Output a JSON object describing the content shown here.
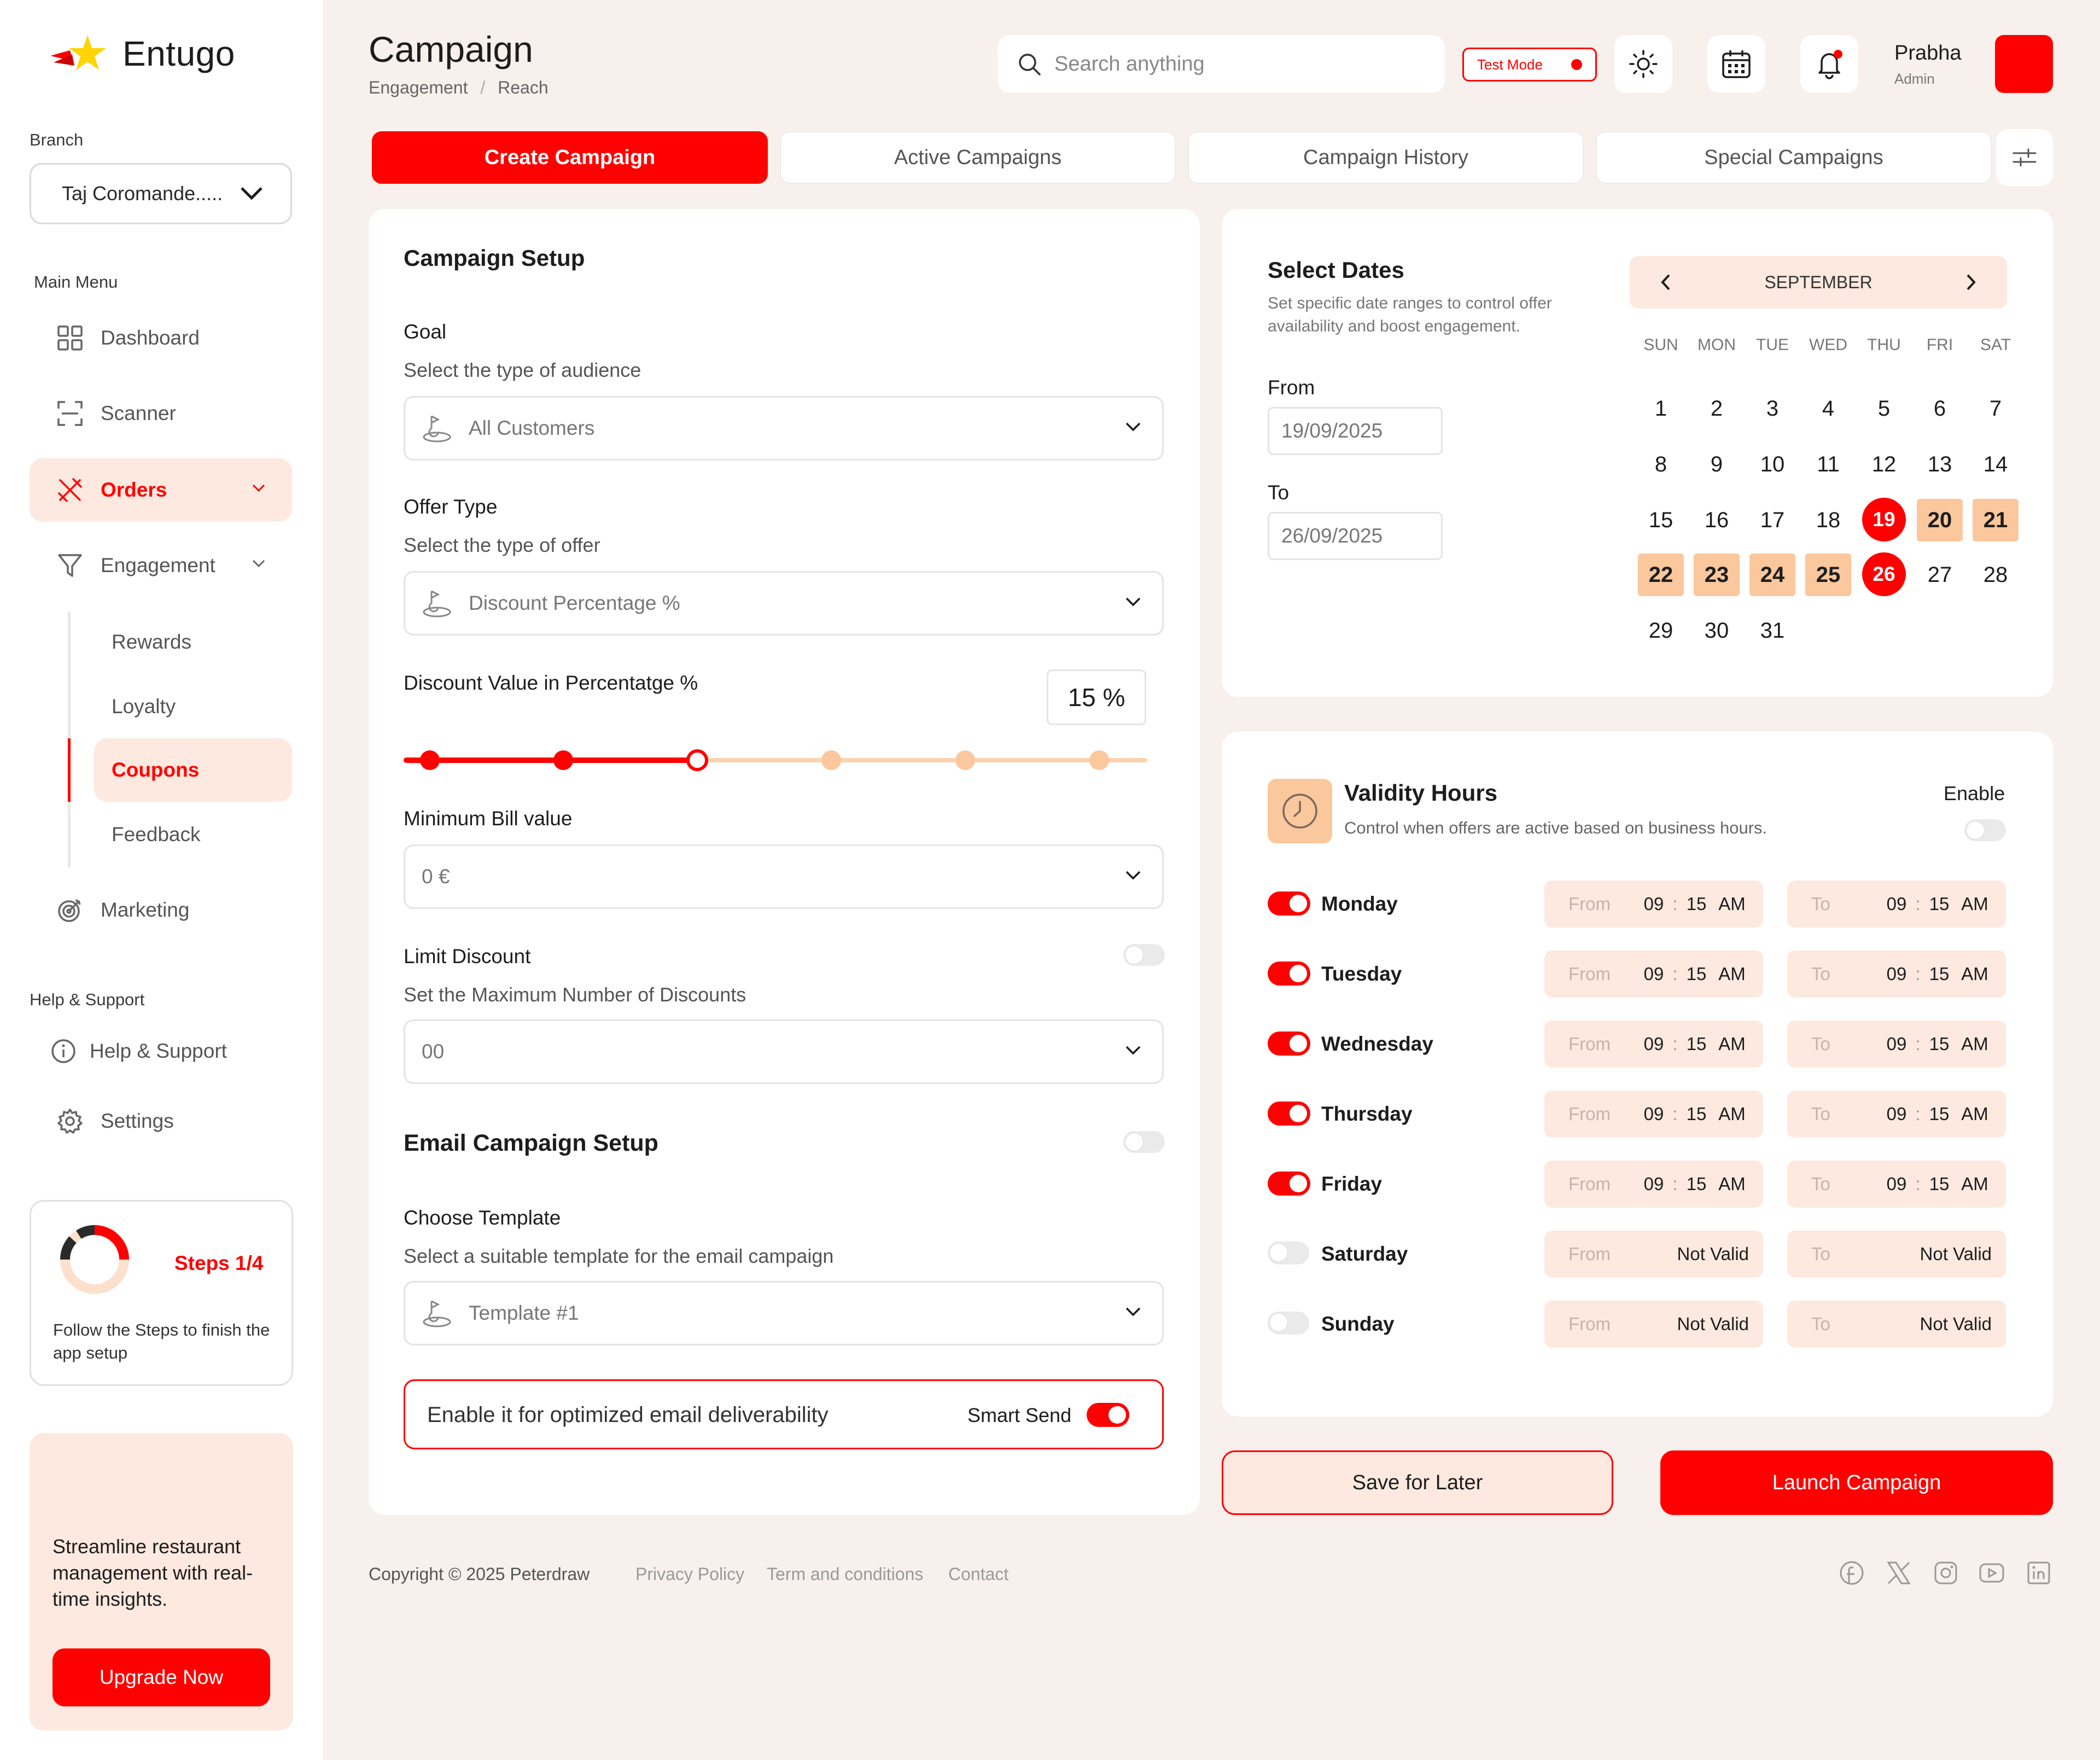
{
  "app": {
    "name": "Entugo"
  },
  "sidebar": {
    "branch_label": "Branch",
    "branch_value": "Taj Coromande.....",
    "main_menu_label": "Main Menu",
    "items": {
      "dashboard": "Dashboard",
      "scanner": "Scanner",
      "orders": "Orders",
      "engagement": "Engagement",
      "marketing": "Marketing"
    },
    "sub_items": {
      "rewards": "Rewards",
      "loyalty": "Loyalty",
      "coupons": "Coupons",
      "feedback": "Feedback"
    },
    "help_label": "Help & Support",
    "help_items": {
      "help": "Help & Support",
      "settings": "Settings"
    },
    "steps": {
      "label": "Steps 1/4",
      "text": "Follow the Steps to finish the  app setup",
      "progress": 0.25
    },
    "upgrade": {
      "text": "Streamline restaurant management with real-time insights.",
      "button": "Upgrade Now"
    }
  },
  "header": {
    "title": "Campaign",
    "breadcrumb": [
      "Engagement",
      "Reach"
    ],
    "breadcrumb_sep": "/",
    "search_placeholder": "Search anything",
    "test_mode": "Test Mode",
    "user_name": "Prabha",
    "user_role": "Admin"
  },
  "tabs": {
    "create": "Create Campaign",
    "active": "Active Campaigns",
    "history": "Campaign History",
    "special": "Special Campaigns"
  },
  "setup": {
    "title": "Campaign Setup",
    "goal_label": "Goal",
    "goal_hint": "Select the type of audience",
    "goal_value": "All Customers",
    "offer_label": "Offer Type",
    "offer_hint": "Select the type of offer",
    "offer_value": "Discount Percentage %",
    "discount_label": "Discount Value in Percentatge %",
    "discount_value": "15 %",
    "slider_level": 0.4,
    "min_bill_label": "Minimum Bill value",
    "min_bill_value": "0 €",
    "limit_label": "Limit Discount",
    "limit_hint": "Set the Maximum Number of Discounts",
    "limit_value": "00",
    "email_title": "Email Campaign Setup",
    "template_label": "Choose Template",
    "template_hint": "Select a suitable template for the email campaign",
    "template_value": "Template #1",
    "smart_text": "Enable it for optimized email deliverability",
    "smart_label": "Smart Send"
  },
  "dates": {
    "title": "Select Dates",
    "desc": "Set specific date ranges to control offer availability and boost engagement.",
    "from_label": "From",
    "from_value": "19/09/2025",
    "to_label": "To",
    "to_value": "26/09/2025",
    "month": "SEPTEMBER",
    "weekdays": [
      "SUN",
      "MON",
      "TUE",
      "WED",
      "THU",
      "FRI",
      "SAT"
    ],
    "days": [
      "1",
      "2",
      "3",
      "4",
      "5",
      "6",
      "7",
      "8",
      "9",
      "10",
      "11",
      "12",
      "13",
      "14",
      "15",
      "16",
      "17",
      "18",
      "19",
      "20",
      "21",
      "22",
      "23",
      "24",
      "25",
      "26",
      "27",
      "28",
      "29",
      "30",
      "31"
    ]
  },
  "validity": {
    "title": "Validity Hours",
    "desc": "Control when offers are active based on business hours.",
    "enable_label": "Enable",
    "from_word": "From",
    "to_word": "To",
    "colon": ":",
    "days": [
      {
        "name": "Monday",
        "hour": "09",
        "min": "15",
        "ampm": "AM"
      },
      {
        "name": "Tuesday",
        "hour": "09",
        "min": "15",
        "ampm": "AM"
      },
      {
        "name": "Wednesday",
        "hour": "09",
        "min": "15",
        "ampm": "AM"
      },
      {
        "name": "Thursday",
        "hour": "09",
        "min": "15",
        "ampm": "AM"
      },
      {
        "name": "Friday",
        "hour": "09",
        "min": "15",
        "ampm": "AM"
      },
      {
        "name": "Saturday",
        "not_valid": "Not Valid"
      },
      {
        "name": "Sunday",
        "not_valid": "Not Valid"
      }
    ]
  },
  "actions": {
    "save": "Save for Later",
    "launch": "Launch Campaign"
  },
  "footer": {
    "copyright": "Copyright © 2025 Peterdraw",
    "links": [
      "Privacy Policy",
      "Term and conditions",
      "Contact"
    ]
  },
  "colors": {
    "accent": "#ff0000",
    "accent_soft": "#fde9df",
    "range": "#fbc79c",
    "background": "#f8f0ec"
  }
}
